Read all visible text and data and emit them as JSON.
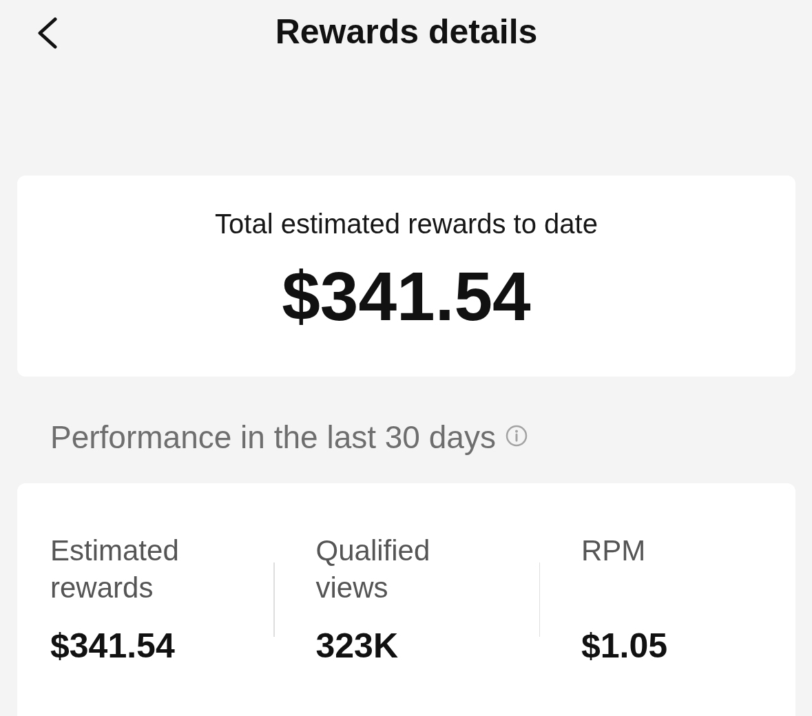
{
  "header": {
    "title": "Rewards details"
  },
  "total_card": {
    "label": "Total estimated rewards to date",
    "amount": "$341.54"
  },
  "performance": {
    "title": "Performance in the last 30 days",
    "metrics": [
      {
        "label": "Estimated rewards",
        "value": "$341.54"
      },
      {
        "label": "Qualified views",
        "value": "323K"
      },
      {
        "label": "RPM",
        "value": "$1.05"
      }
    ]
  }
}
